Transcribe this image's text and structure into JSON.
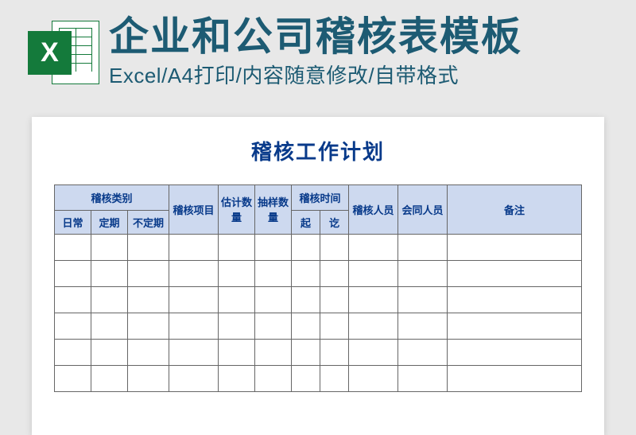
{
  "header": {
    "icon_letter": "X",
    "main_title": "企业和公司稽核表模板",
    "subtitle": "Excel/A4打印/内容随意修改/自带格式"
  },
  "document": {
    "title": "稽核工作计划",
    "columns": {
      "category_group": "稽核类别",
      "category_daily": "日常",
      "category_periodic": "定期",
      "category_nonperiodic": "不定期",
      "project": "稽核项目",
      "estimate_qty": "估计数量",
      "sample_qty": "抽样数量",
      "time_group": "稽核时间",
      "time_from": "起",
      "time_to": "讫",
      "auditor": "稽核人员",
      "co_auditor": "会同人员",
      "remarks": "备注"
    },
    "body_row_count": 6
  }
}
